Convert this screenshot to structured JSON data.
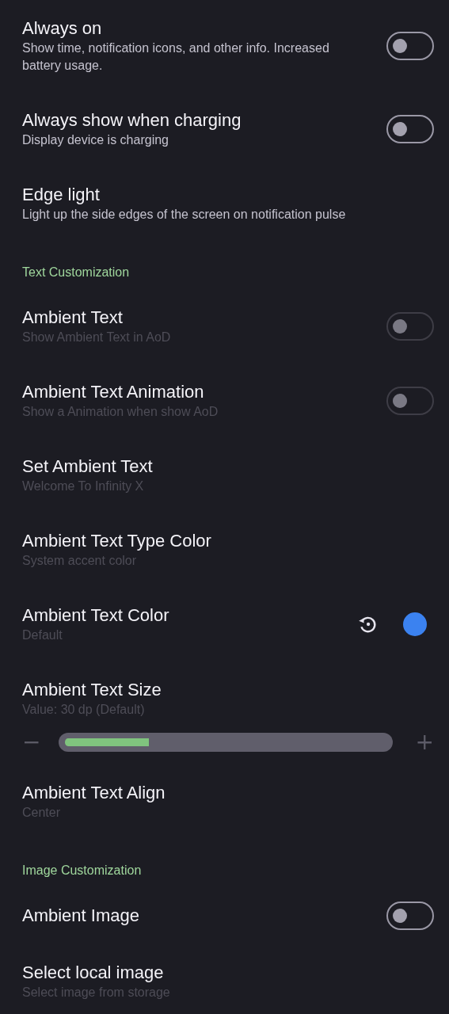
{
  "sections": [
    {
      "items": [
        {
          "kind": "switch",
          "title": "Always on",
          "summary": "Show time, notification icons, and other info. Increased battery usage.",
          "on": false,
          "disabled": false
        },
        {
          "kind": "switch",
          "title": "Always show when charging",
          "summary": "Display device is charging",
          "on": false,
          "disabled": false
        },
        {
          "kind": "text",
          "title": "Edge light",
          "summary": "Light up the side edges of the screen on notification pulse",
          "disabled": false
        }
      ]
    },
    {
      "header": "Text Customization",
      "items": [
        {
          "kind": "switch",
          "title": "Ambient Text",
          "summary": "Show Ambient Text in AoD",
          "on": false,
          "disabled": true
        },
        {
          "kind": "switch",
          "title": "Ambient Text Animation",
          "summary": "Show a Animation when show AoD",
          "on": false,
          "disabled": true
        },
        {
          "kind": "text",
          "title": "Set Ambient Text",
          "summary": "Welcome To Infinity X",
          "disabled": true
        },
        {
          "kind": "text",
          "title": "Ambient Text Type Color",
          "summary": "System accent color",
          "disabled": true
        },
        {
          "kind": "color",
          "title": "Ambient Text Color",
          "summary": "Default",
          "color": "#3b82f0",
          "disabled": true
        },
        {
          "kind": "slider",
          "title": "Ambient Text Size",
          "summary": "Value: 30 dp (Default)",
          "level": 0.27,
          "minus": "−",
          "plus": "+",
          "disabled": true
        },
        {
          "kind": "text",
          "title": "Ambient Text Align",
          "summary": "Center",
          "disabled": true
        }
      ]
    },
    {
      "header": "Image Customization",
      "items": [
        {
          "kind": "switch",
          "title": "Ambient Image",
          "on": false,
          "disabled": false
        },
        {
          "kind": "text",
          "title": "Select local image",
          "summary": "Select image from storage",
          "disabled": true
        }
      ]
    }
  ]
}
